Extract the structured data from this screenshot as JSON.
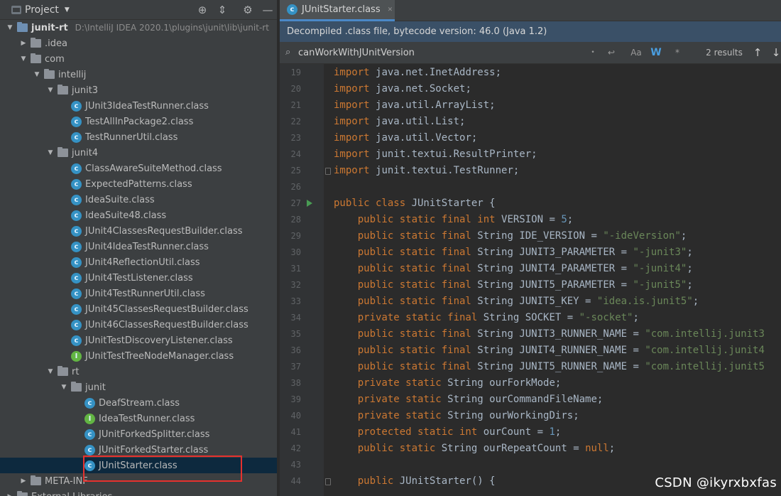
{
  "project": {
    "title": "Project",
    "rows": [
      {
        "label": "junit-rt",
        "path": "D:\\IntelliJ IDEA 2020.1\\plugins\\junit\\lib\\junit-rt",
        "indent": 0,
        "arrow": "▼",
        "icon": "module"
      },
      {
        "label": ".idea",
        "indent": 1,
        "arrow": "▶",
        "icon": "folder"
      },
      {
        "label": "com",
        "indent": 1,
        "arrow": "▼",
        "icon": "folder"
      },
      {
        "label": "intellij",
        "indent": 2,
        "arrow": "▼",
        "icon": "folder"
      },
      {
        "label": "junit3",
        "indent": 3,
        "arrow": "▼",
        "icon": "folder"
      },
      {
        "label": "JUnit3IdeaTestRunner.class",
        "indent": 4,
        "arrow": "",
        "icon": "class"
      },
      {
        "label": "TestAllInPackage2.class",
        "indent": 4,
        "arrow": "",
        "icon": "class"
      },
      {
        "label": "TestRunnerUtil.class",
        "indent": 4,
        "arrow": "",
        "icon": "class"
      },
      {
        "label": "junit4",
        "indent": 3,
        "arrow": "▼",
        "icon": "folder"
      },
      {
        "label": "ClassAwareSuiteMethod.class",
        "indent": 4,
        "arrow": "",
        "icon": "class"
      },
      {
        "label": "ExpectedPatterns.class",
        "indent": 4,
        "arrow": "",
        "icon": "class"
      },
      {
        "label": "IdeaSuite.class",
        "indent": 4,
        "arrow": "",
        "icon": "class"
      },
      {
        "label": "IdeaSuite48.class",
        "indent": 4,
        "arrow": "",
        "icon": "class"
      },
      {
        "label": "JUnit4ClassesRequestBuilder.class",
        "indent": 4,
        "arrow": "",
        "icon": "class"
      },
      {
        "label": "JUnit4IdeaTestRunner.class",
        "indent": 4,
        "arrow": "",
        "icon": "class"
      },
      {
        "label": "JUnit4ReflectionUtil.class",
        "indent": 4,
        "arrow": "",
        "icon": "class"
      },
      {
        "label": "JUnit4TestListener.class",
        "indent": 4,
        "arrow": "",
        "icon": "class"
      },
      {
        "label": "JUnit4TestRunnerUtil.class",
        "indent": 4,
        "arrow": "",
        "icon": "class"
      },
      {
        "label": "JUnit45ClassesRequestBuilder.class",
        "indent": 4,
        "arrow": "",
        "icon": "class"
      },
      {
        "label": "JUnit46ClassesRequestBuilder.class",
        "indent": 4,
        "arrow": "",
        "icon": "class"
      },
      {
        "label": "JUnitTestDiscoveryListener.class",
        "indent": 4,
        "arrow": "",
        "icon": "class"
      },
      {
        "label": "JUnitTestTreeNodeManager.class",
        "indent": 4,
        "arrow": "",
        "icon": "interface"
      },
      {
        "label": "rt",
        "indent": 3,
        "arrow": "▼",
        "icon": "folder"
      },
      {
        "label": "junit",
        "indent": 4,
        "arrow": "▼",
        "icon": "folder"
      },
      {
        "label": "DeafStream.class",
        "indent": 5,
        "arrow": "",
        "icon": "class"
      },
      {
        "label": "IdeaTestRunner.class",
        "indent": 5,
        "arrow": "",
        "icon": "interface"
      },
      {
        "label": "JUnitForkedSplitter.class",
        "indent": 5,
        "arrow": "",
        "icon": "class"
      },
      {
        "label": "JUnitForkedStarter.class",
        "indent": 5,
        "arrow": "",
        "icon": "class"
      },
      {
        "label": "JUnitStarter.class",
        "indent": 5,
        "arrow": "",
        "icon": "class",
        "selected": true
      },
      {
        "label": "META-INF",
        "indent": 1,
        "arrow": "▶",
        "icon": "folder"
      },
      {
        "label": "External Libraries",
        "indent": 0,
        "arrow": "▶",
        "icon": "library"
      }
    ]
  },
  "editor": {
    "tab_label": "JUnitStarter.class",
    "banner": "Decompiled .class file, bytecode version: 46.0 (Java 1.2)",
    "search_value": "canWorkWithJUnitVersion",
    "search_word_toggle": "W",
    "search_case_toggle": "Aa",
    "search_regex_toggle": "*",
    "search_results": "2 results",
    "line_numbers": [
      "19",
      "20",
      "21",
      "22",
      "23",
      "24",
      "25",
      "26",
      "27",
      "28",
      "29",
      "30",
      "31",
      "32",
      "33",
      "34",
      "35",
      "36",
      "37",
      "38",
      "39",
      "40",
      "41",
      "42",
      "43",
      "44"
    ],
    "code_lines": [
      [
        [
          "kw",
          "import "
        ],
        [
          "id",
          "java.net.InetAddress;"
        ]
      ],
      [
        [
          "kw",
          "import "
        ],
        [
          "id",
          "java.net.Socket;"
        ]
      ],
      [
        [
          "kw",
          "import "
        ],
        [
          "id",
          "java.util.ArrayList;"
        ]
      ],
      [
        [
          "kw",
          "import "
        ],
        [
          "id",
          "java.util.List;"
        ]
      ],
      [
        [
          "kw",
          "import "
        ],
        [
          "id",
          "java.util.Vector;"
        ]
      ],
      [
        [
          "kw",
          "import "
        ],
        [
          "id",
          "junit.textui.ResultPrinter;"
        ]
      ],
      [
        [
          "kw",
          "import "
        ],
        [
          "id",
          "junit.textui.TestRunner;"
        ]
      ],
      [],
      [
        [
          "kw",
          "public class "
        ],
        [
          "id",
          "JUnitStarter {"
        ]
      ],
      [
        [
          "id",
          "    "
        ],
        [
          "kw",
          "public static final int "
        ],
        [
          "field",
          "VERSION"
        ],
        [
          "id",
          " = "
        ],
        [
          "num",
          "5"
        ],
        [
          "id",
          ";"
        ]
      ],
      [
        [
          "id",
          "    "
        ],
        [
          "kw",
          "public static final "
        ],
        [
          "id",
          "String "
        ],
        [
          "field",
          "IDE_VERSION"
        ],
        [
          "id",
          " = "
        ],
        [
          "str",
          "\"-ideVersion\""
        ],
        [
          "id",
          ";"
        ]
      ],
      [
        [
          "id",
          "    "
        ],
        [
          "kw",
          "public static final "
        ],
        [
          "id",
          "String "
        ],
        [
          "field",
          "JUNIT3_PARAMETER"
        ],
        [
          "id",
          " = "
        ],
        [
          "str",
          "\"-junit3\""
        ],
        [
          "id",
          ";"
        ]
      ],
      [
        [
          "id",
          "    "
        ],
        [
          "kw",
          "public static final "
        ],
        [
          "id",
          "String "
        ],
        [
          "field",
          "JUNIT4_PARAMETER"
        ],
        [
          "id",
          " = "
        ],
        [
          "str",
          "\"-junit4\""
        ],
        [
          "id",
          ";"
        ]
      ],
      [
        [
          "id",
          "    "
        ],
        [
          "kw",
          "public static final "
        ],
        [
          "id",
          "String "
        ],
        [
          "field",
          "JUNIT5_PARAMETER"
        ],
        [
          "id",
          " = "
        ],
        [
          "str",
          "\"-junit5\""
        ],
        [
          "id",
          ";"
        ]
      ],
      [
        [
          "id",
          "    "
        ],
        [
          "kw",
          "public static final "
        ],
        [
          "id",
          "String "
        ],
        [
          "field",
          "JUNIT5_KEY"
        ],
        [
          "id",
          " = "
        ],
        [
          "str",
          "\"idea.is.junit5\""
        ],
        [
          "id",
          ";"
        ]
      ],
      [
        [
          "id",
          "    "
        ],
        [
          "kw",
          "private static final "
        ],
        [
          "id",
          "String "
        ],
        [
          "field",
          "SOCKET"
        ],
        [
          "id",
          " = "
        ],
        [
          "str",
          "\"-socket\""
        ],
        [
          "id",
          ";"
        ]
      ],
      [
        [
          "id",
          "    "
        ],
        [
          "kw",
          "public static final "
        ],
        [
          "id",
          "String "
        ],
        [
          "field",
          "JUNIT3_RUNNER_NAME"
        ],
        [
          "id",
          " = "
        ],
        [
          "str",
          "\"com.intellij.junit3"
        ]
      ],
      [
        [
          "id",
          "    "
        ],
        [
          "kw",
          "public static final "
        ],
        [
          "id",
          "String "
        ],
        [
          "field",
          "JUNIT4_RUNNER_NAME"
        ],
        [
          "id",
          " = "
        ],
        [
          "str",
          "\"com.intellij.junit4"
        ]
      ],
      [
        [
          "id",
          "    "
        ],
        [
          "kw",
          "public static final "
        ],
        [
          "id",
          "String "
        ],
        [
          "field",
          "JUNIT5_RUNNER_NAME"
        ],
        [
          "id",
          " = "
        ],
        [
          "str",
          "\"com.intellij.junit5"
        ]
      ],
      [
        [
          "id",
          "    "
        ],
        [
          "kw",
          "private static "
        ],
        [
          "id",
          "String "
        ],
        [
          "field",
          "ourForkMode"
        ],
        [
          "id",
          ";"
        ]
      ],
      [
        [
          "id",
          "    "
        ],
        [
          "kw",
          "private static "
        ],
        [
          "id",
          "String "
        ],
        [
          "field",
          "ourCommandFileName"
        ],
        [
          "id",
          ";"
        ]
      ],
      [
        [
          "id",
          "    "
        ],
        [
          "kw",
          "private static "
        ],
        [
          "id",
          "String "
        ],
        [
          "field",
          "ourWorkingDirs"
        ],
        [
          "id",
          ";"
        ]
      ],
      [
        [
          "id",
          "    "
        ],
        [
          "kw",
          "protected static int "
        ],
        [
          "field",
          "ourCount"
        ],
        [
          "id",
          " = "
        ],
        [
          "num",
          "1"
        ],
        [
          "id",
          ";"
        ]
      ],
      [
        [
          "id",
          "    "
        ],
        [
          "kw",
          "public static "
        ],
        [
          "id",
          "String "
        ],
        [
          "field",
          "ourRepeatCount"
        ],
        [
          "id",
          " = "
        ],
        [
          "kw",
          "null"
        ],
        [
          "id",
          ";"
        ]
      ],
      [],
      [
        [
          "id",
          "    "
        ],
        [
          "kw",
          "public "
        ],
        [
          "id",
          "JUnitStarter() {"
        ]
      ]
    ]
  },
  "watermark": "CSDN @ikyrxbxfas",
  "colors": {
    "keyword": "#cc7832",
    "string": "#6a8759",
    "number": "#6897bb",
    "identifier": "#a9b7c6",
    "selection": "#0d293e",
    "highlight_box": "#e5312e",
    "banner": "#3a5067"
  }
}
